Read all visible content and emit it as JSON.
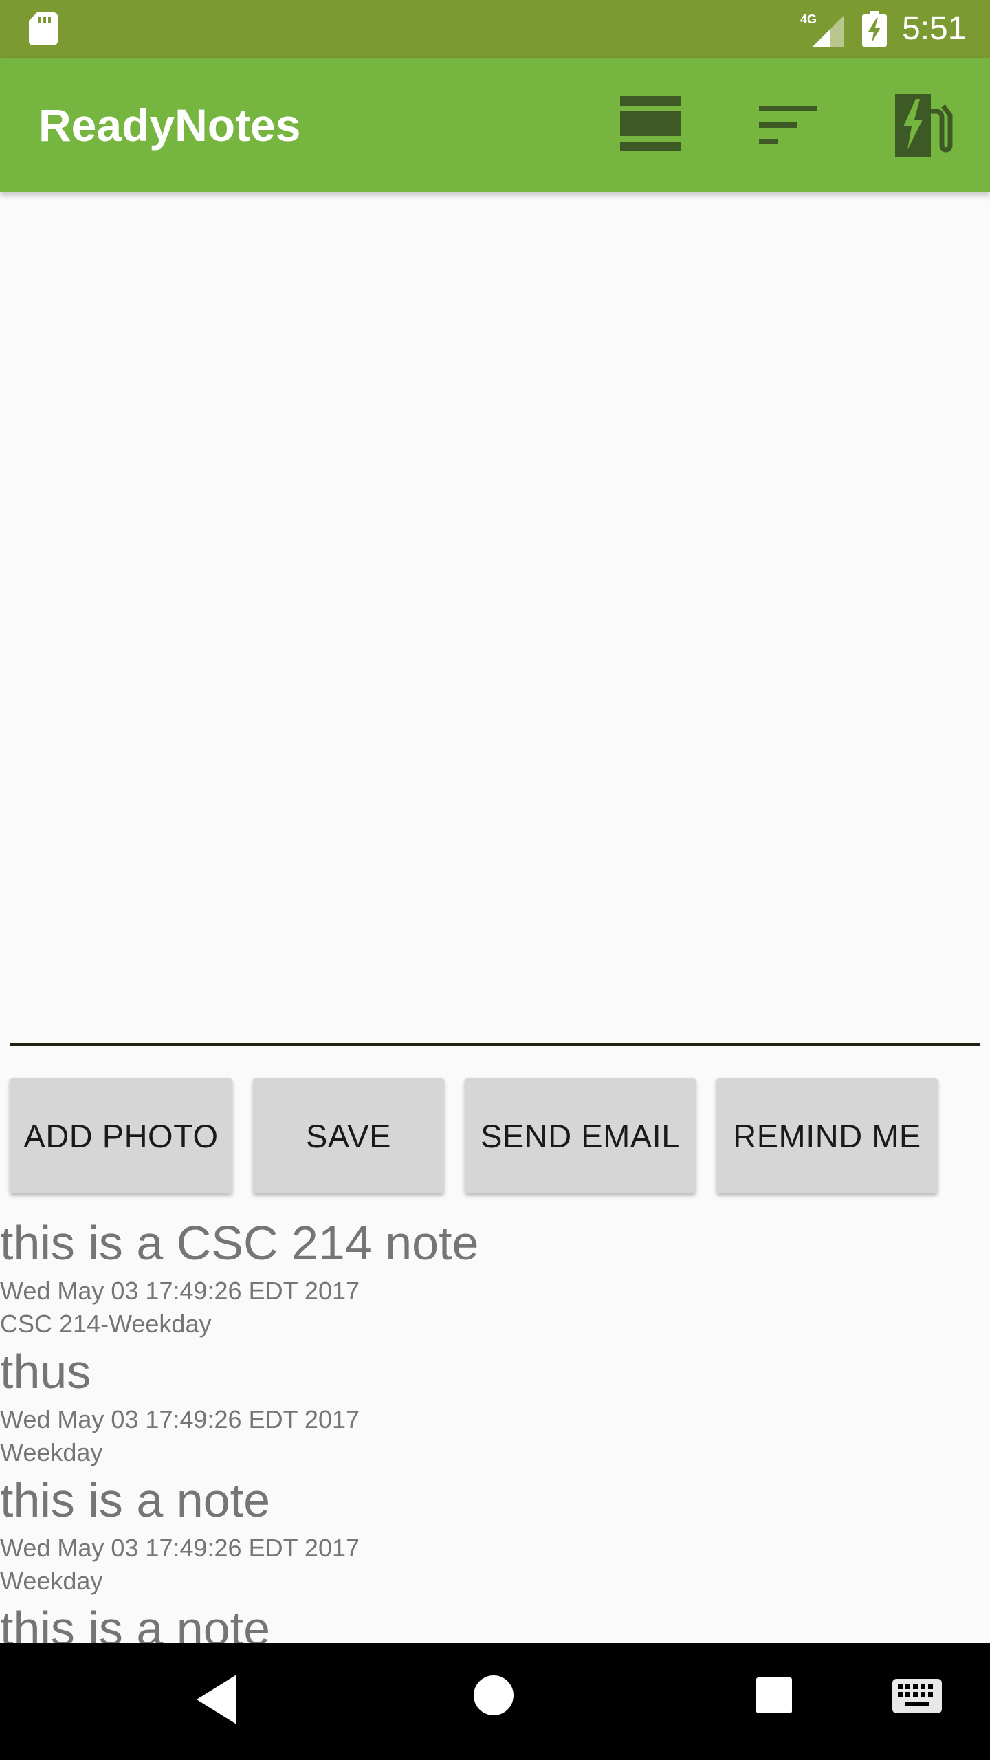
{
  "status_bar": {
    "network": "4G",
    "time": "5:51",
    "icons": [
      "sd-card-icon",
      "signal-4g-icon",
      "battery-charging-icon"
    ]
  },
  "app_bar": {
    "title": "ReadyNotes",
    "actions": [
      "view-agenda-icon",
      "sort-icon",
      "ev-station-icon"
    ]
  },
  "editor": {
    "value": "",
    "placeholder": ""
  },
  "buttons": {
    "add_photo": "ADD PHOTO",
    "save": "SAVE",
    "send_email": "SEND EMAIL",
    "remind_me": "REMIND ME"
  },
  "notes": [
    {
      "title": "this is a CSC 214 note",
      "date": "Wed May 03 17:49:26 EDT 2017",
      "category": "CSC 214-Weekday"
    },
    {
      "title": "thus",
      "date": "Wed May 03 17:49:26 EDT 2017",
      "category": "Weekday"
    },
    {
      "title": "this is a note",
      "date": "Wed May 03 17:49:26 EDT 2017",
      "category": "Weekday"
    },
    {
      "title": "this is a note",
      "date": "",
      "category": ""
    }
  ],
  "nav_bar": {
    "icons": [
      "back-icon",
      "home-icon",
      "recents-icon",
      "keyboard-icon"
    ]
  },
  "colors": {
    "status_bar": "#7c9a32",
    "app_bar": "#76b53f",
    "toolbar_icon": "#3d5a26",
    "button_bg": "#d6d6d6",
    "note_text": "#757575"
  }
}
